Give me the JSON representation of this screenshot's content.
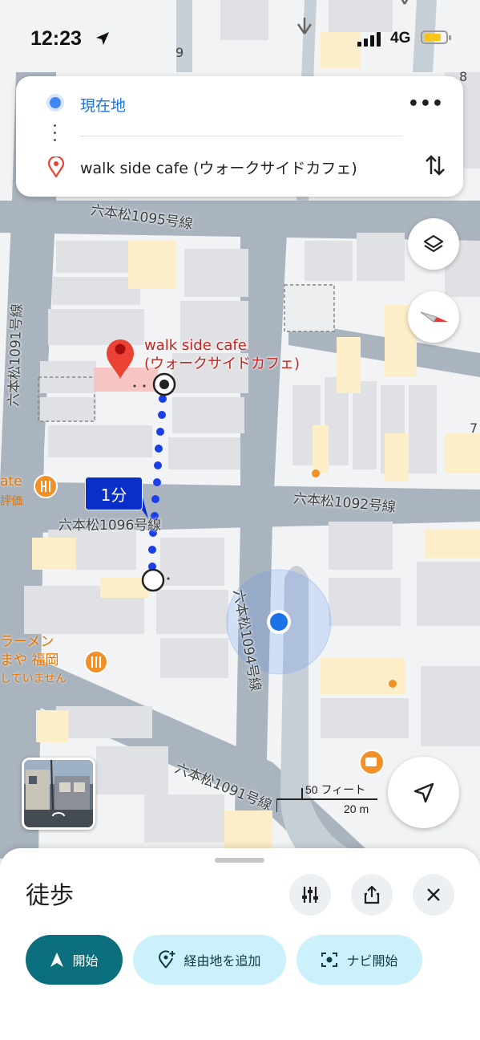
{
  "status_bar": {
    "time": "12:23",
    "network": "4G"
  },
  "directions": {
    "origin_label": "現在地",
    "destination_label": "walk side cafe (ウォークサイドカフェ)",
    "more_label": "•••"
  },
  "map": {
    "destination_name_line1": "walk side cafe",
    "destination_name_line2": "(ウォークサイドカフェ)",
    "duration_badge": "1分",
    "roads": {
      "r1095": "六本松1095号線",
      "r1096": "六本松1096号線",
      "r1092": "六本松1092号線",
      "r1091_diag": "六本松1091号線",
      "r1091_vert": "六本松1091号線",
      "r1094": "六本松1094号線"
    },
    "poi": {
      "left_ate": "ate",
      "left_hyouka": "評価",
      "ramen_line1": "ラーメン",
      "ramen_line2": "まや 福岡",
      "ramen_line3": "していません"
    },
    "street_numbers": {
      "n9": "9",
      "n8": "8",
      "n7": "7"
    },
    "scale": {
      "imperial": "50 フィート",
      "metric": "20 m"
    }
  },
  "sheet": {
    "mode_title": "徒歩",
    "start_label": "開始",
    "add_stop_label": "経由地を追加",
    "navi_label": "ナビ開始"
  },
  "colors": {
    "route_blue": "#1a3fe8",
    "badge_blue": "#0a2fc8",
    "pin_red": "#ea4335",
    "poi_orange": "#f29028",
    "primary_teal": "#0b6e7c",
    "secondary_cyan": "#cdf1fb"
  }
}
